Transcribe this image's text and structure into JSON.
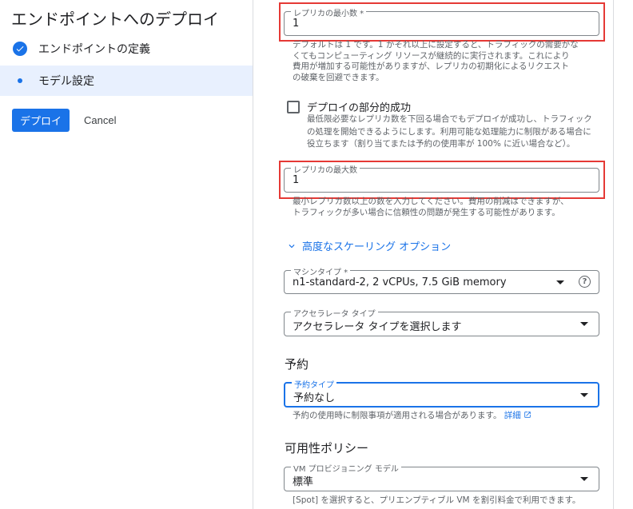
{
  "sidebar": {
    "title": "エンドポイントへのデプロイ",
    "steps": [
      {
        "label": "エンドポイントの定義",
        "state": "complete",
        "icon": "check-circle-icon"
      },
      {
        "label": "モデル設定",
        "state": "current",
        "icon": "dot-icon"
      }
    ],
    "deploy_label": "デプロイ",
    "cancel_label": "Cancel"
  },
  "form": {
    "min_replica": {
      "label": "レプリカの最小数 *",
      "value": "1"
    },
    "min_replica_help": [
      "デフォルトは 1 です。1 かそれ以上に設定すると、トラフィックの需要がな",
      "くてもコンピューティング リソースが継続的に実行されます。これにより",
      "費用が増加する可能性がありますが、レプリカの初期化によるリクエスト",
      "の破棄を回避できます。"
    ],
    "partial_success": {
      "label": "デプロイの部分的成功",
      "checked": false,
      "help": [
        "最低限必要なレプリカ数を下回る場合でもデプロイが成功し、トラフィック",
        "の処理を開始できるようにします。利用可能な処理能力に制限がある場合に",
        "役立ちます（割り当てまたは予約の使用率が 100% に近い場合など）。"
      ]
    },
    "max_replica": {
      "label": "レプリカの最大数",
      "value": "1"
    },
    "max_replica_help": [
      "最小レプリカ数以上の数を入力してください。費用の削減はできますが、",
      "トラフィックが多い場合に信頼性の問題が発生する可能性があります。"
    ],
    "advanced_label": "高度なスケーリング オプション",
    "machine_type": {
      "label": "マシンタイプ *",
      "value": "n1-standard-2, 2 vCPUs, 7.5 GiB memory"
    },
    "accelerator": {
      "label": "アクセラレータ タイプ",
      "value": "アクセラレータ タイプを選択します"
    },
    "reservation_heading": "予約",
    "reservation_type": {
      "label": "予約タイプ",
      "value": "予約なし"
    },
    "reservation_help": "予約の使用時に制限事項が適用される場合があります。",
    "reservation_link": "詳細",
    "availability_heading": "可用性ポリシー",
    "vm_provisioning": {
      "label": "VM プロビジョニング モデル",
      "value": "標準"
    },
    "vm_help": "[Spot] を選択すると、プリエンプティブル VM を割引料金で利用できます。"
  },
  "colors": {
    "accent": "#1a73e8",
    "highlight": "#e53935"
  }
}
